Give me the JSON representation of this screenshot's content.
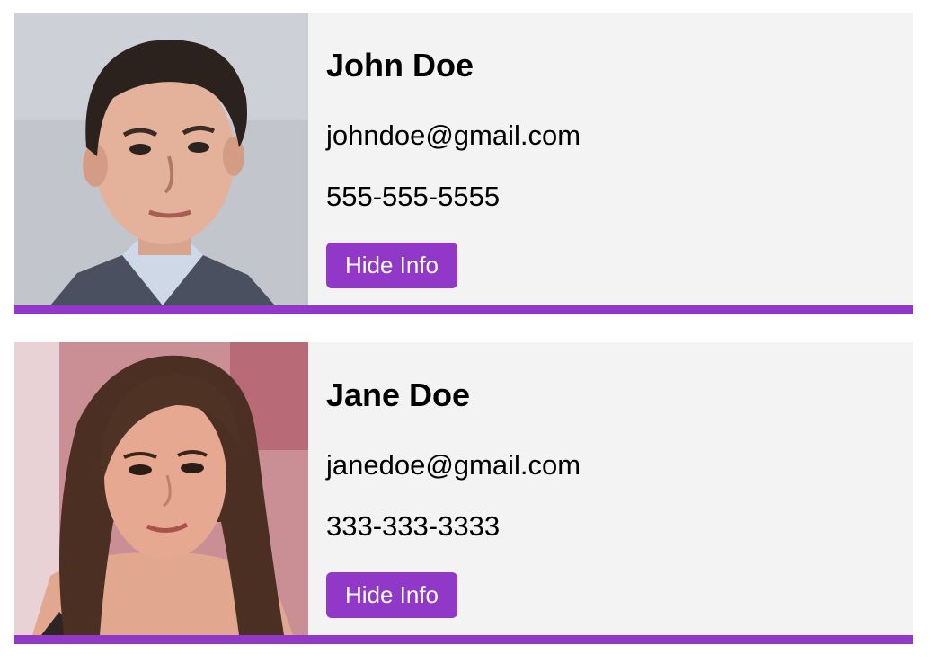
{
  "contacts": [
    {
      "name": "John Doe",
      "email": "johndoe@gmail.com",
      "phone": "555-555-5555",
      "button_label": "Hide Info"
    },
    {
      "name": "Jane Doe",
      "email": "janedoe@gmail.com",
      "phone": "333-333-3333",
      "button_label": "Hide Info"
    }
  ],
  "colors": {
    "accent": "#9138c8",
    "card_background": "#f3f3f3"
  }
}
